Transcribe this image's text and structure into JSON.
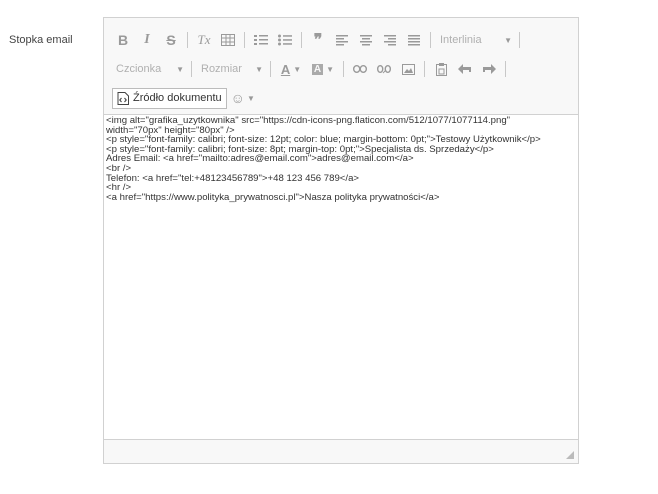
{
  "field": {
    "label": "Stopka email"
  },
  "toolbar": {
    "format_label": "Interlinia",
    "font_label": "Czcionka",
    "size_label": "Rozmiar",
    "source_label": "Źródło dokumentu",
    "icons": {
      "bold": "B",
      "italic": "I",
      "strike": "S",
      "clear_format": "Tx",
      "table": "table-icon",
      "ordered_list": "ordered-list-icon",
      "bullet_list": "bullet-list-icon",
      "blockquote": "❞",
      "align_left": "align-left-icon",
      "align_center": "align-center-icon",
      "align_right": "align-right-icon",
      "align_justify": "align-justify-icon",
      "text_color": "A",
      "bg_color": "A",
      "link": "link-icon",
      "unlink": "unlink-icon",
      "image": "image-icon",
      "paste": "paste-icon",
      "undo": "undo-icon",
      "redo": "redo-icon",
      "emoji": "☺"
    }
  },
  "source": {
    "lines": [
      "<img alt=\"grafika_uzytkownika\" src=\"https://cdn-icons-png.flaticon.com/512/1077/1077114.png\"",
      "width=\"70px\" height=\"80px\" />",
      "<p style=\"font-family: calibri; font-size: 12pt; color: blue; margin-bottom: 0pt;\">Testowy Użytkownik</p>",
      "<p style=\"font-family: calibri; font-size: 8pt; margin-top: 0pt;\">Specjalista ds. Sprzedaży</p>",
      "Adres Email: <a href=\"mailto:adres@email.com\">adres@email.com</a>",
      "<br />",
      "Telefon: <a href=\"tel:+48123456789\">+48 123 456 789</a>",
      "<hr />",
      "<a href=\"https://www.polityka_prywatnosci.pl\">Nasza polityka prywatności</a>"
    ]
  },
  "colors": {
    "icon": "#9a9a9a",
    "border": "#d1d1d1",
    "toolbar_bg": "#f8f8f8"
  }
}
